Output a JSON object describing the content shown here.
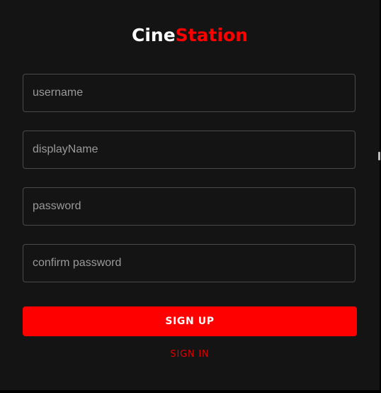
{
  "logo": {
    "part1": "Cine",
    "part2": "Station"
  },
  "form": {
    "username_placeholder": "username",
    "username_value": "",
    "display_name_placeholder": "displayName",
    "display_name_value": "",
    "password_placeholder": "password",
    "password_value": "",
    "confirm_password_placeholder": "confirm password",
    "confirm_password_value": "",
    "sign_up_label": "SIGN UP",
    "sign_in_label": "SIGN IN"
  },
  "colors": {
    "background": "#141414",
    "accent": "#ff0000",
    "field_border": "#4a4a4a",
    "placeholder": "#9a9a9a"
  }
}
